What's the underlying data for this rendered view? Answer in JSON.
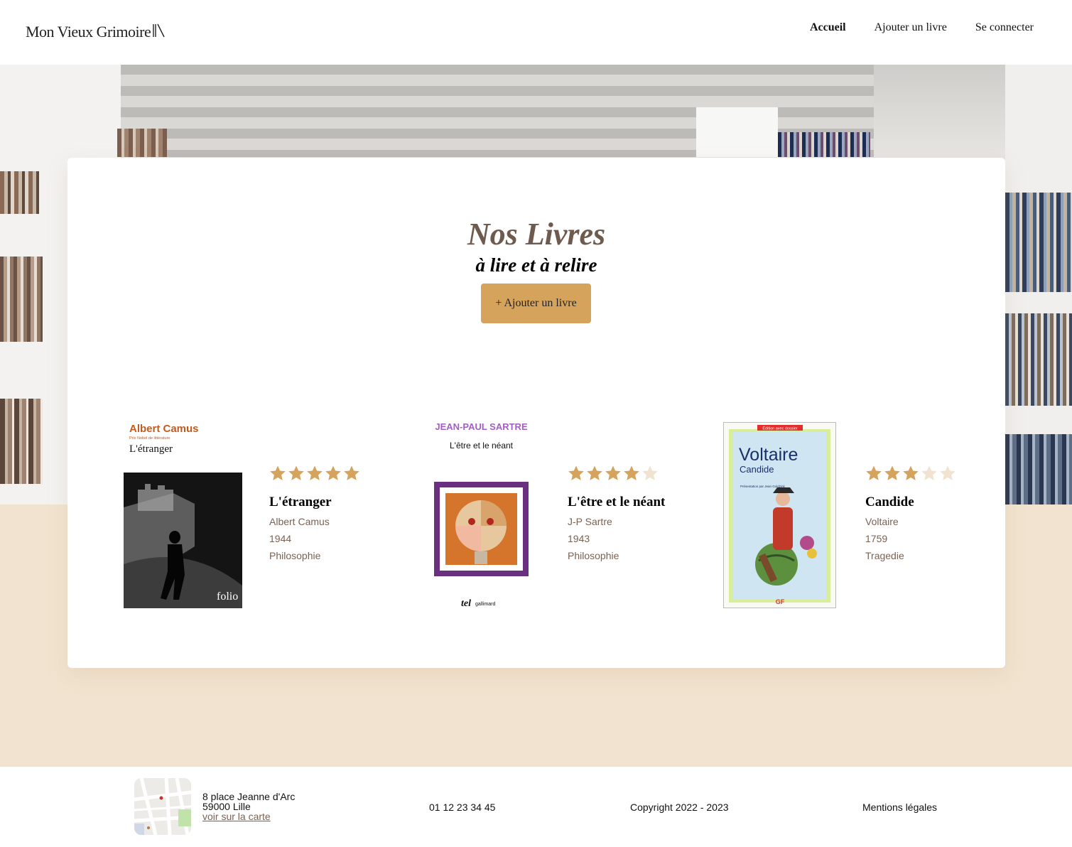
{
  "header": {
    "logo": "Mon Vieux Grimoire",
    "nav": [
      {
        "label": "Accueil",
        "active": true
      },
      {
        "label": "Ajouter un livre",
        "active": false
      },
      {
        "label": "Se connecter",
        "active": false
      }
    ]
  },
  "main": {
    "title": "Nos Livres",
    "subtitle": "à lire et à relire",
    "add_button": "+ Ajouter un livre"
  },
  "books": [
    {
      "title": "L'étranger",
      "author": "Albert Camus",
      "year": "1944",
      "genre": "Philosophie",
      "rating": 5,
      "cover": {
        "author_text": "Albert Camus",
        "prize_text": "Prix Nobel de littérature",
        "title_text": "L'étranger",
        "publisher": "folio"
      }
    },
    {
      "title": "L'être et le néant",
      "author": "J-P Sartre",
      "year": "1943",
      "genre": "Philosophie",
      "rating": 4,
      "cover": {
        "author_text": "JEAN-PAUL SARTRE",
        "title_text": "L'être et le néant",
        "publisher_a": "tel",
        "publisher_b": "gallimard"
      }
    },
    {
      "title": "Candide",
      "author": "Voltaire",
      "year": "1759",
      "genre": "Tragedie",
      "rating": 3,
      "cover": {
        "banner": "Édition avec dossier",
        "author_text": "Voltaire",
        "title_text": "Candide",
        "presentation": "Présentation par Jean Goldzink",
        "publisher": "GF"
      }
    }
  ],
  "footer": {
    "address_line1": "8 place Jeanne d'Arc",
    "address_line2": "59000 Lille",
    "map_link": "voir sur la carte",
    "phone": "01 12 23 34 45",
    "copyright": "Copyright 2022 - 2023",
    "legal": "Mentions légales"
  },
  "colors": {
    "accent": "#d6a35c",
    "brown": "#6f5b4e",
    "beige": "#f1e3cf",
    "star_filled": "#d6a35c",
    "star_empty": "#f1e3cf"
  }
}
